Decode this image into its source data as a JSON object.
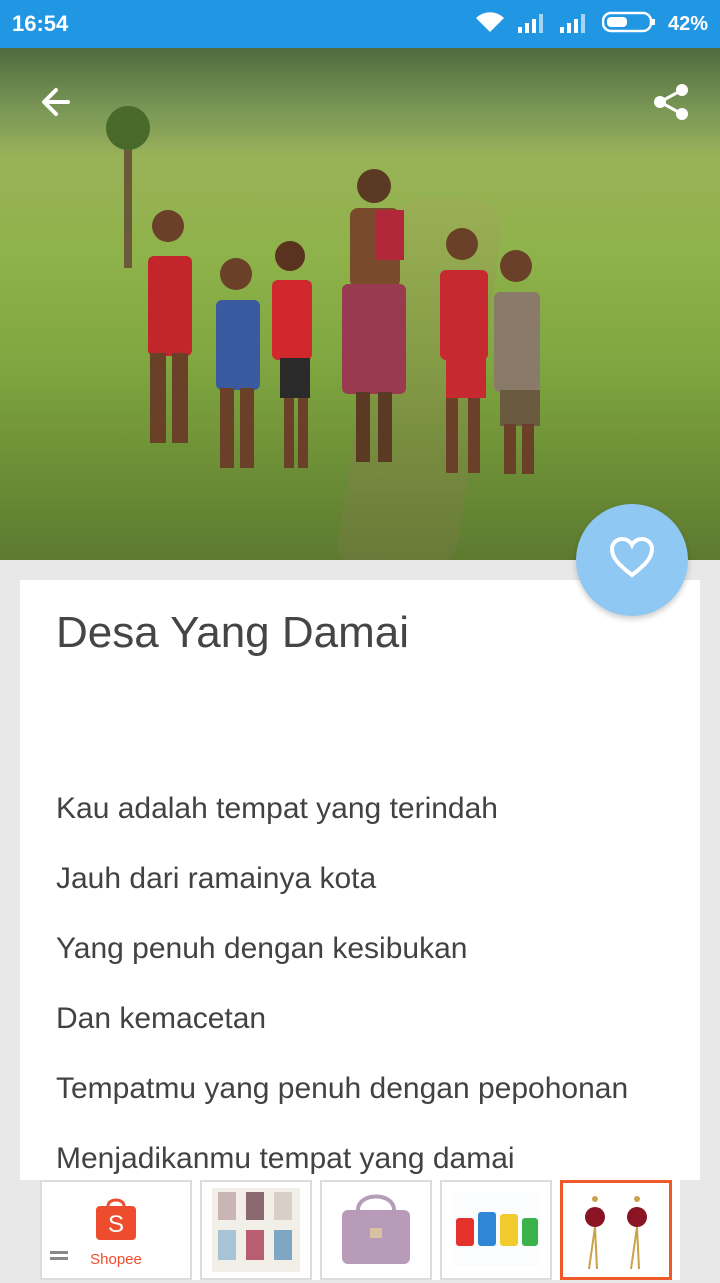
{
  "status_bar": {
    "time": "16:54",
    "battery": "42%",
    "icons": [
      "wifi-icon",
      "signal-icon",
      "signal-icon",
      "battery-icon"
    ]
  },
  "header": {
    "back_icon": "arrow-back-icon",
    "share_icon": "share-icon"
  },
  "favorite_icon": "heart-icon",
  "poem": {
    "title": "Desa Yang Damai",
    "lines": [
      "Kau adalah tempat yang terindah",
      "Jauh dari ramainya kota",
      "Yang penuh dengan kesibukan",
      "Dan kemacetan",
      "Tempatmu yang penuh dengan pepohonan",
      "Menjadikanmu tempat yang damai"
    ]
  },
  "ads": {
    "brand": "Shopee",
    "accent": "#ee4d2d"
  },
  "colors": {
    "status_bar": "#2196e3",
    "fab": "#90c8f4"
  }
}
